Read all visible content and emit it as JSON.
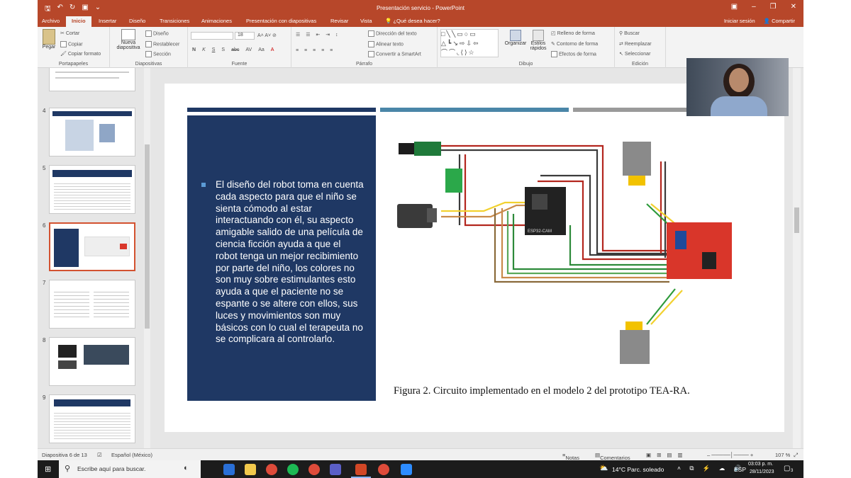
{
  "window": {
    "title": "Presentación servicio - PowerPoint",
    "signin": "Iniciar sesión",
    "share": "Compartir"
  },
  "tabs": [
    "Archivo",
    "Inicio",
    "Insertar",
    "Diseño",
    "Transiciones",
    "Animaciones",
    "Presentación con diapositivas",
    "Revisar",
    "Vista"
  ],
  "active_tab": "Inicio",
  "tell_me": "¿Qué desea hacer?",
  "ribbon": {
    "groups": [
      "Portapapeles",
      "Diapositivas",
      "Fuente",
      "Párrafo",
      "Dibujo",
      "Edición"
    ],
    "paste": "Pegar",
    "cut": "Cortar",
    "copy": "Copiar",
    "format_painter": "Copiar formato",
    "new_slide_1": "Nueva",
    "new_slide_2": "diapositiva",
    "layout": "Diseño",
    "reset": "Restablecer",
    "section": "Sección",
    "font_size": "18",
    "text_direction": "Dirección del texto",
    "align_text": "Alinear texto",
    "smartart": "Convertir a SmartArt",
    "arrange": "Organizar",
    "quick_styles_1": "Estilos",
    "quick_styles_2": "rápidos",
    "shape_fill": "Relleno de forma",
    "shape_outline": "Contorno de forma",
    "shape_effects": "Efectos de forma",
    "find": "Buscar",
    "replace": "Reemplazar",
    "select": "Seleccionar",
    "font_buttons": [
      "N",
      "K",
      "S",
      "abc",
      "AV",
      "Aa",
      "A"
    ]
  },
  "thumbnails": [
    "4",
    "5",
    "6",
    "7",
    "8",
    "9"
  ],
  "selected_slide": "6",
  "slide": {
    "body_text": "El diseño del robot toma en cuenta cada aspecto para que el niño se sienta cómodo al estar interactuando con él, su aspecto amigable salido de una película de ciencia ficción ayuda a que el robot tenga un mejor recibimiento por parte del niño, los colores no son muy sobre estimulantes esto ayuda a que el paciente no se espante o se altere con ellos, sus luces y movimientos son muy básicos con lo cual el terapeuta no se complicara al controlarlo.",
    "caption": "Figura 2. Circuito implementado en el modelo 2 del prototipo TEA-RA.",
    "board_label": "ESP32-CAM",
    "colors": {
      "navy": "#1f3864",
      "teal": "#4a86a8",
      "gray": "#9a9a9a"
    }
  },
  "status": {
    "slide_info": "Diapositiva 6 de 13",
    "language": "Español (México)",
    "notes": "Notas",
    "comments": "Comentarios",
    "zoom": "107 %"
  },
  "taskbar": {
    "search": "Escribe aquí para buscar.",
    "weather": "14°C  Parc. soleado",
    "lang": "ESP",
    "time": "03:03 p. m.",
    "date": "28/11/2023",
    "notifications": "3"
  },
  "accent_color": "#b7472a"
}
